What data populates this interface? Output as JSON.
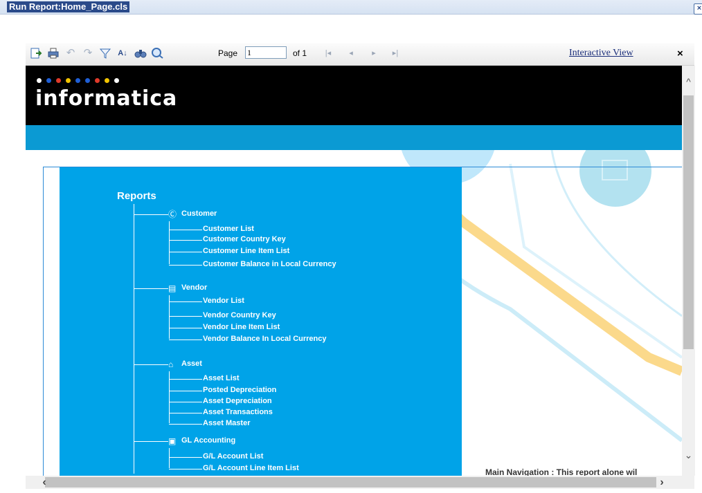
{
  "window": {
    "title": "Run Report:Home_Page.cls",
    "close_icon": "close-icon"
  },
  "toolbar": {
    "icons": [
      "export-icon",
      "print-icon",
      "undo-icon",
      "redo-icon",
      "filter-icon",
      "sort-icon",
      "find-icon",
      "zoom-icon"
    ],
    "page_label": "Page",
    "page_value": "1",
    "of_label": "of 1",
    "interactive_view": "Interactive View",
    "close_label": "×"
  },
  "banner": {
    "logo_text": "informatica",
    "dot_colors": [
      "#ffffff",
      "#1f5fd6",
      "#e03a2a",
      "#f2c400",
      "#1f5fd6",
      "#1f5fd6",
      "#e03a2a",
      "#f2c400",
      "#ffffff"
    ]
  },
  "report": {
    "heading": "Reports",
    "categories": [
      {
        "name": "Customer",
        "icon": "customer-icon",
        "items": [
          "Customer List",
          "Customer Country Key",
          "Customer Line Item List",
          "Customer Balance in Local Currency"
        ]
      },
      {
        "name": "Vendor",
        "icon": "vendor-icon",
        "items": [
          "Vendor List",
          "Vendor Country Key",
          "Vendor Line Item List",
          "Vendor Balance In Local Currency"
        ]
      },
      {
        "name": "Asset",
        "icon": "asset-icon",
        "items": [
          "Asset List",
          "Posted Depreciation",
          "Asset Depreciation",
          "Asset Transactions",
          "Asset Master"
        ]
      },
      {
        "name": "GL Accounting",
        "icon": "gl-accounting-icon",
        "items": [
          "G/L Account List",
          "G/L Account Line Item List"
        ]
      }
    ],
    "main_navigation": "Main Navigation : This report alone wil"
  },
  "colors": {
    "panel_blue": "#00a3e8",
    "banner_black": "#000000",
    "strip_blue": "#0b9ad3"
  }
}
